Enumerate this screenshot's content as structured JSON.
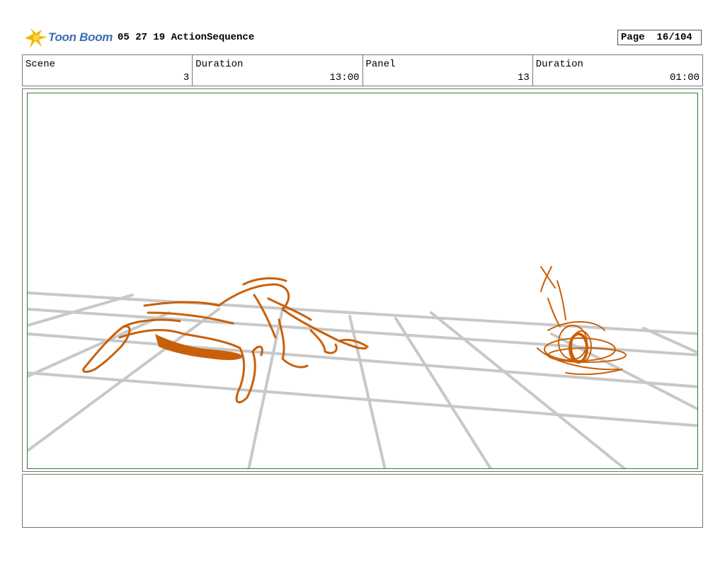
{
  "header": {
    "logo_text": "Toon Boom",
    "title": "05 27 19 ActionSequence",
    "page_label": "Page",
    "page_value": "16/104"
  },
  "info": {
    "scene_label": "Scene",
    "scene_value": "3",
    "duration_label": "Duration",
    "duration_value": "13:00",
    "panel_label": "Panel",
    "panel_value": "13",
    "panel_duration_label": "Duration",
    "panel_duration_value": "01:00"
  },
  "colors": {
    "sketch": "#c8600a",
    "grid": "#c8c8c8",
    "frame": "#2e7d32",
    "logo_text": "#3a6fb0",
    "logo_burst": "#f2b705"
  },
  "notes": {
    "text": ""
  }
}
